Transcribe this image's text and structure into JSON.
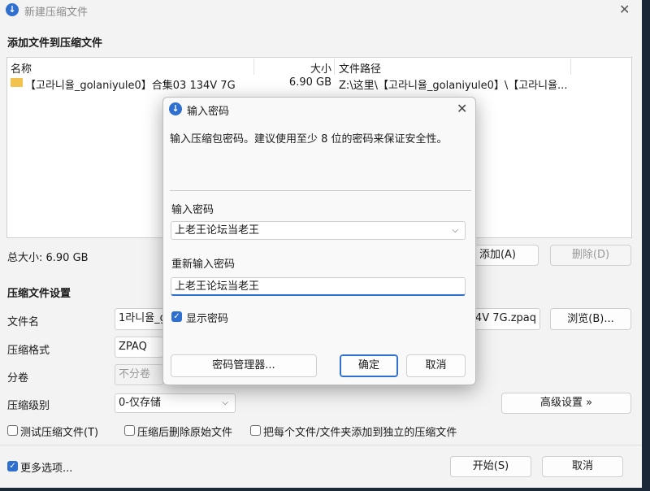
{
  "main_window": {
    "title": "新建压缩文件",
    "section_add": "添加文件到压缩文件",
    "columns": [
      "名称",
      "大小",
      "文件路径"
    ],
    "rows": [
      {
        "name": "【고라니율_golaniyule0】合集03 134V 7G",
        "size": "6.90 GB",
        "path": "Z:\\这里\\【고라니율_golaniyule0】\\【고라니율..."
      }
    ],
    "total_size": "总大小: 6.90 GB",
    "add_button": "添加(A)",
    "delete_button": "删除(D)",
    "section_settings": "压缩文件设置",
    "filename_label": "文件名",
    "filename_value_left": "1라니율_g",
    "filename_value_right": "34V 7G.zpaq",
    "browse_button": "浏览(B)...",
    "format_label": "压缩格式",
    "format_value": "ZPAQ",
    "volume_label": "分卷",
    "volume_value": "不分卷",
    "level_label": "压缩级别",
    "level_value": "0-仅存储",
    "advanced_button": "高级设置 »",
    "test_checkbox": "测试压缩文件(T)",
    "delete_after_checkbox": "压缩后删除原始文件",
    "separate_checkbox": "把每个文件/文件夹添加到独立的压缩文件",
    "more_options": "更多选项...",
    "start_button": "开始(S)",
    "cancel_button": "取消"
  },
  "dialog": {
    "title": "输入密码",
    "hint": "输入压缩包密码。建议使用至少 8 位的密码来保证安全性。",
    "password_label": "输入密码",
    "password_value": "上老王论坛当老王",
    "confirm_label": "重新输入密码",
    "confirm_value": "上老王论坛当老王",
    "show_password": "显示密码",
    "manager_button": "密码管理器...",
    "ok_button": "确定",
    "cancel_button": "取消"
  },
  "icons": {
    "close": "close-icon",
    "folder": "folder-icon",
    "logo": "app-logo-icon",
    "chevron": "chevron-down-icon"
  },
  "colors": {
    "accent": "#2f6fd0",
    "folder": "#f2c14e"
  }
}
